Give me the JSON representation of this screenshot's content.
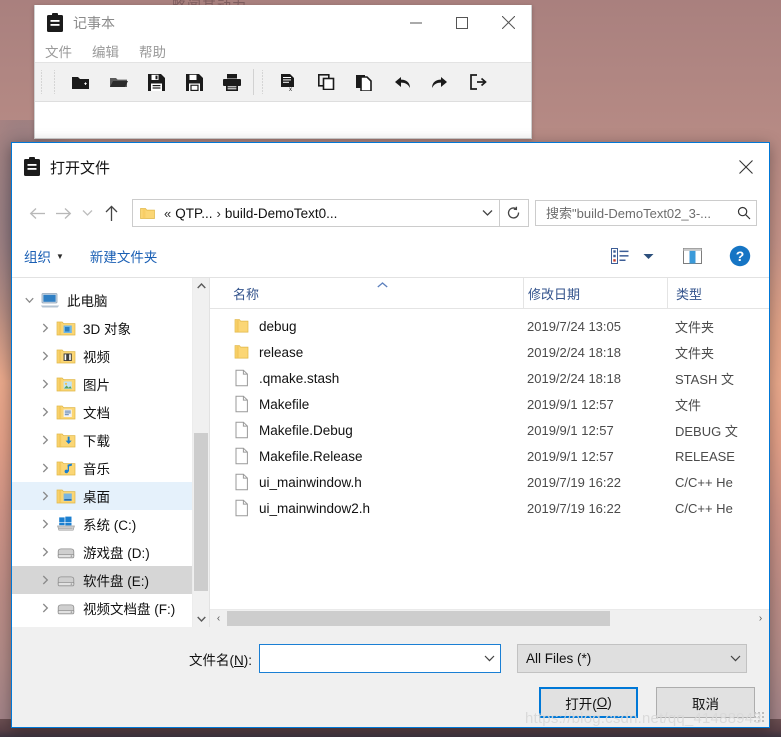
{
  "desktop": {
    "partial_text": "略闻其动力",
    "watermark": "https://blog.csdn.net/qq_41488943",
    "colors": {
      "sky_top": "#a9807e",
      "sky_glow": "#eaa98c",
      "ground": "#5a4147"
    }
  },
  "notepad": {
    "title": "记事本",
    "app_icon": "clipboard-icon",
    "window_buttons": [
      {
        "name": "minimize",
        "glyph": "minimize-icon"
      },
      {
        "name": "maximize",
        "glyph": "maximize-icon"
      },
      {
        "name": "close",
        "glyph": "close-icon"
      }
    ],
    "menus": [
      {
        "label": "文件"
      },
      {
        "label": "编辑"
      },
      {
        "label": "帮助"
      }
    ],
    "toolbar_group1": [
      {
        "name": "new-file-icon",
        "tip": "新建"
      },
      {
        "name": "open-folder-icon",
        "tip": "打开"
      },
      {
        "name": "save-icon",
        "tip": "保存"
      },
      {
        "name": "save-as-icon",
        "tip": "另存为"
      },
      {
        "name": "print-icon",
        "tip": "打印"
      }
    ],
    "toolbar_group2": [
      {
        "name": "cut-icon",
        "tip": "剪切"
      },
      {
        "name": "copy-icon",
        "tip": "复制"
      },
      {
        "name": "paste-icon",
        "tip": "粘贴"
      },
      {
        "name": "undo-icon",
        "tip": "撤销"
      },
      {
        "name": "redo-icon",
        "tip": "重做"
      },
      {
        "name": "exit-icon",
        "tip": "退出"
      }
    ]
  },
  "dialog": {
    "title": "打开文件",
    "app_icon": "clipboard-icon",
    "close_label": "关闭",
    "nav": {
      "back_icon": "arrow-left-icon",
      "forward_icon": "arrow-right-icon",
      "recent_icon": "chevron-down-icon",
      "up_icon": "arrow-up-icon",
      "refresh_icon": "refresh-icon",
      "folder_icon": "folder-icon",
      "breadcrumb_sep": "«",
      "crumbs": [
        {
          "label": "QTP..."
        },
        {
          "label": "build-DemoText0..."
        }
      ],
      "crumb_arrow": "›",
      "dropdown_icon": "chevron-down-icon"
    },
    "search": {
      "placeholder": "搜索\"build-DemoText02_3-...",
      "value": "",
      "icon": "search-icon"
    },
    "commandbar": {
      "organize_label": "组织",
      "organize_caret": "▼",
      "new_folder_label": "新建文件夹",
      "view_icon": "view-list-icon",
      "view_caret": "▼",
      "preview_icon": "preview-pane-icon",
      "help_icon": "help-icon",
      "help_glyph": "?"
    },
    "sidebar": {
      "items": [
        {
          "label": "此电脑",
          "icon": "pc-icon",
          "level": 0,
          "twisty": "v",
          "state": "normal"
        },
        {
          "label": "3D 对象",
          "icon": "folder-3d-icon",
          "level": 1,
          "twisty": ">",
          "state": "normal"
        },
        {
          "label": "视频",
          "icon": "folder-video-icon",
          "level": 1,
          "twisty": ">",
          "state": "normal"
        },
        {
          "label": "图片",
          "icon": "folder-pictures-icon",
          "level": 1,
          "twisty": ">",
          "state": "normal"
        },
        {
          "label": "文档",
          "icon": "folder-documents-icon",
          "level": 1,
          "twisty": ">",
          "state": "normal"
        },
        {
          "label": "下载",
          "icon": "folder-downloads-icon",
          "level": 1,
          "twisty": ">",
          "state": "normal"
        },
        {
          "label": "音乐",
          "icon": "folder-music-icon",
          "level": 1,
          "twisty": ">",
          "state": "normal"
        },
        {
          "label": "桌面",
          "icon": "folder-desktop-icon",
          "level": 1,
          "twisty": ">",
          "state": "selected-light"
        },
        {
          "label": "系统 (C:)",
          "icon": "drive-windows-icon",
          "level": 1,
          "twisty": ">",
          "state": "normal"
        },
        {
          "label": "游戏盘 (D:)",
          "icon": "drive-icon",
          "level": 1,
          "twisty": ">",
          "state": "normal"
        },
        {
          "label": "软件盘 (E:)",
          "icon": "drive-icon",
          "level": 1,
          "twisty": ">",
          "state": "selected-grey"
        },
        {
          "label": "视频文档盘 (F:)",
          "icon": "drive-icon",
          "level": 1,
          "twisty": ">",
          "state": "normal"
        }
      ],
      "scroll_up": "︿",
      "scroll_down": "﹀"
    },
    "filelist": {
      "columns": [
        {
          "key": "name",
          "label": "名称",
          "sorted": true,
          "sort_dir": "asc"
        },
        {
          "key": "date",
          "label": "修改日期"
        },
        {
          "key": "type",
          "label": "类型"
        }
      ],
      "sort_caret": "︿",
      "rows": [
        {
          "name": "debug",
          "icon": "folder-icon",
          "date": "2019/7/24 13:05",
          "type": "文件夹"
        },
        {
          "name": "release",
          "icon": "folder-icon",
          "date": "2019/2/24 18:18",
          "type": "文件夹"
        },
        {
          "name": ".qmake.stash",
          "icon": "file-icon",
          "date": "2019/2/24 18:18",
          "type": "STASH 文"
        },
        {
          "name": "Makefile",
          "icon": "file-icon",
          "date": "2019/9/1 12:57",
          "type": "文件"
        },
        {
          "name": "Makefile.Debug",
          "icon": "file-icon",
          "date": "2019/9/1 12:57",
          "type": "DEBUG 文"
        },
        {
          "name": "Makefile.Release",
          "icon": "file-icon",
          "date": "2019/9/1 12:57",
          "type": "RELEASE "
        },
        {
          "name": "ui_mainwindow.h",
          "icon": "file-icon",
          "date": "2019/7/19 16:22",
          "type": "C/C++ He"
        },
        {
          "name": "ui_mainwindow2.h",
          "icon": "file-icon",
          "date": "2019/7/19 16:22",
          "type": "C/C++ He"
        }
      ],
      "hscroll": {
        "left_arrow": "‹",
        "right_arrow": "›"
      }
    },
    "bottom": {
      "filename_label_prefix": "文件名(",
      "filename_label_mnemonic": "N",
      "filename_label_suffix": "):",
      "filename_value": "",
      "filename_placeholder": "",
      "filter_value": "All Files  (*)",
      "open_button": {
        "prefix": "打开(",
        "mnemonic": "O",
        "suffix": ")"
      },
      "cancel_button": "取消"
    },
    "accent_color": "#0078d7"
  }
}
